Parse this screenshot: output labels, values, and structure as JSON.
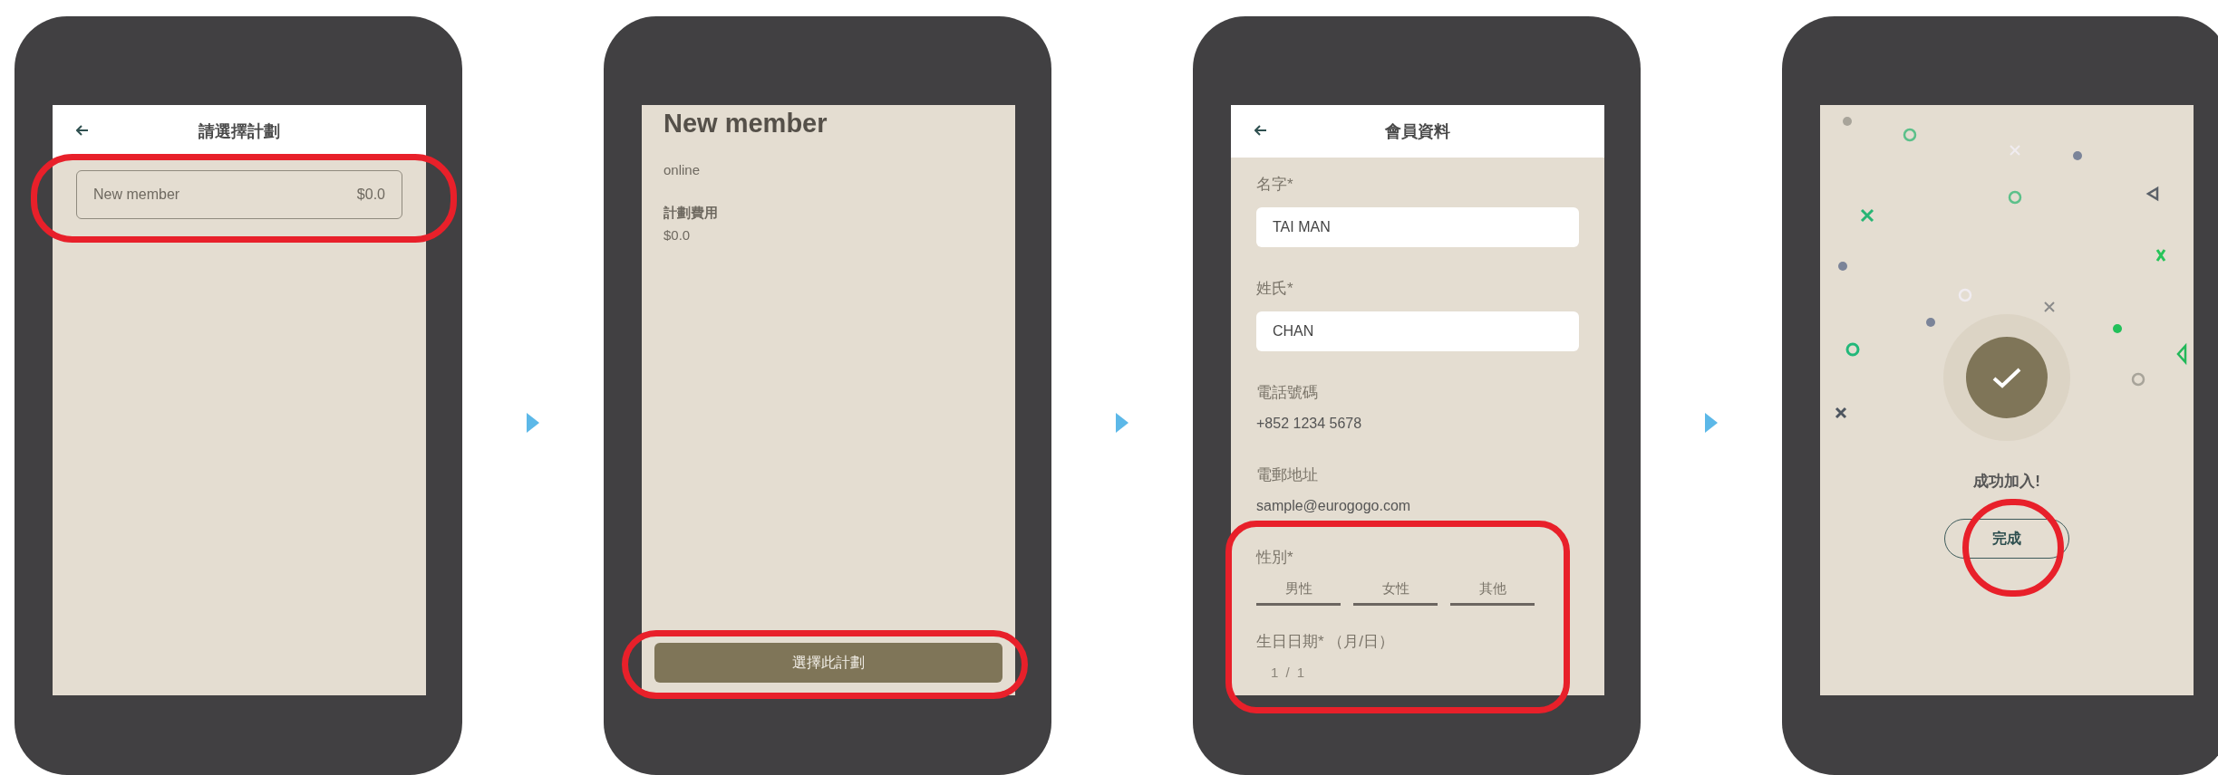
{
  "flow": [
    {
      "kind": "plan_list",
      "header": {
        "title": "請選擇計劃"
      },
      "plans": [
        {
          "name": "New member",
          "price": "$0.0",
          "circled": true
        }
      ]
    },
    {
      "kind": "plan_detail",
      "title": "New member",
      "description": "online",
      "fee_label": "計劃費用",
      "fee": "$0.0",
      "button": {
        "label": "選擇此計劃",
        "circled": true
      }
    },
    {
      "kind": "member_form",
      "header": {
        "title": "會員資料"
      },
      "fields": [
        {
          "kind": "input",
          "label": "名字*",
          "value": "TAI MAN"
        },
        {
          "kind": "input",
          "label": "姓氏*",
          "value": "CHAN"
        },
        {
          "kind": "text",
          "label": "電話號碼",
          "value": "+852 1234 5678"
        },
        {
          "kind": "text",
          "label": "電郵地址",
          "value": "sample@eurogogo.com"
        }
      ],
      "choices": {
        "label": "性別*",
        "options": [
          "男性",
          "女性",
          "其他"
        ],
        "circled": true
      },
      "birthday": {
        "label": "生日日期* （月/日）",
        "value": "1 / 1"
      }
    },
    {
      "kind": "success",
      "message": "成功加入!",
      "button": {
        "label": "完成",
        "circled": true
      }
    }
  ]
}
